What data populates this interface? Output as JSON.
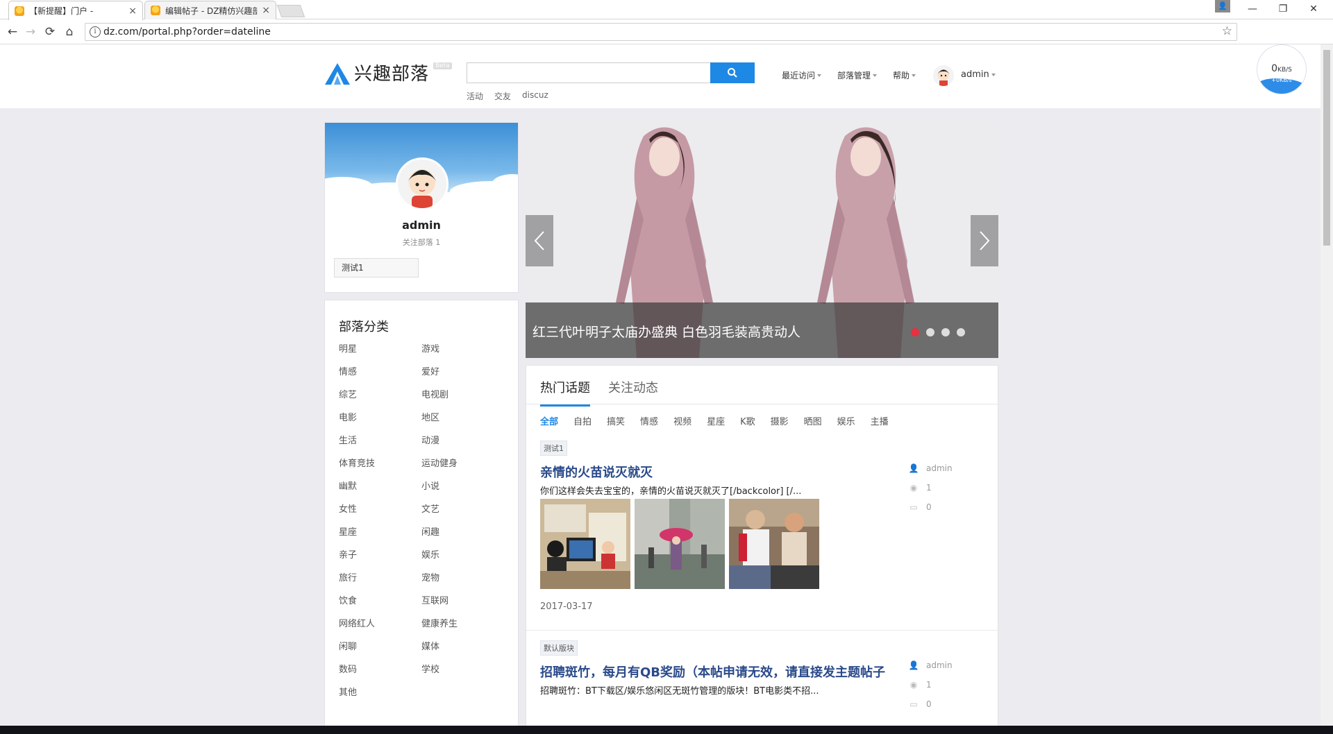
{
  "browser": {
    "tabs": [
      {
        "title": "【新提醒】门户 -",
        "close": "×"
      },
      {
        "title": "编辑帖子 - DZ精仿兴趣部",
        "close": "×"
      }
    ],
    "url": "dz.com/portal.php?order=dateline",
    "window": {
      "minimize": "—",
      "restore": "❐",
      "close": "✕"
    }
  },
  "header": {
    "brand": "兴趣部落",
    "beta": "Beta",
    "search_placeholder": "",
    "hotwords": [
      "活动",
      "交友",
      "discuz"
    ],
    "nav": [
      "最近访问",
      "部落管理",
      "帮助"
    ],
    "username": "admin",
    "speed": {
      "main": "0",
      "unit": "KB/S",
      "sub": "+0KB/s"
    }
  },
  "profile": {
    "name": "admin",
    "follow": "关注部落 1",
    "tag": "测试1"
  },
  "categories": {
    "title": "部落分类",
    "items": [
      "明星",
      "游戏",
      "情感",
      "爱好",
      "综艺",
      "电视剧",
      "电影",
      "地区",
      "生活",
      "动漫",
      "体育竞技",
      "运动健身",
      "幽默",
      "小说",
      "女性",
      "文艺",
      "星座",
      "闲趣",
      "亲子",
      "娱乐",
      "旅行",
      "宠物",
      "饮食",
      "互联网",
      "网络红人",
      "健康养生",
      "闲聊",
      "媒体",
      "数码",
      "学校",
      "其他"
    ]
  },
  "slider": {
    "caption": "红三代叶明子太庙办盛典 白色羽毛装高贵动人",
    "slides": 4,
    "active": 1
  },
  "feed": {
    "tabs": [
      "热门话题",
      "关注动态"
    ],
    "filters": [
      "全部",
      "自拍",
      "搞笑",
      "情感",
      "视频",
      "星座",
      "K歌",
      "摄影",
      "晒图",
      "娱乐",
      "主播"
    ],
    "posts": [
      {
        "badge": "测试1",
        "title": "亲情的火苗说灭就灭",
        "desc": "你们这样会失去宝宝的，亲情的火苗说灭就灭了[/backcolor] [/...",
        "date": "2017-03-17",
        "author": "admin",
        "views": "1",
        "replies": "0"
      },
      {
        "badge": "默认版块",
        "title": "招聘斑竹，每月有QB奖励（本帖申请无效，请直接发主题帖子",
        "desc": "招聘斑竹：BT下载区/娱乐悠闲区无斑竹管理的版块！BT电影类不招...",
        "author": "admin",
        "views": "1",
        "replies": "0"
      }
    ]
  },
  "colors": {
    "accent": "#1e88e5",
    "active_dot": "#e8303f",
    "title_link": "#2a4a8a"
  }
}
